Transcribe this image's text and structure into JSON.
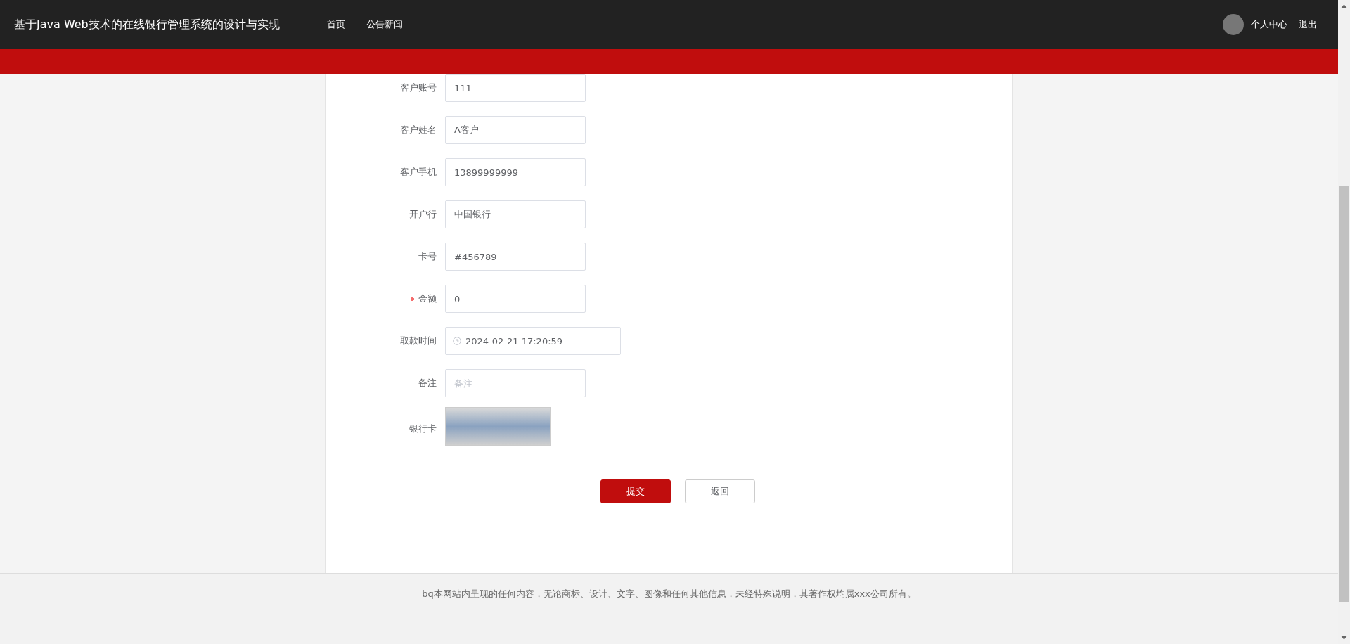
{
  "header": {
    "title": "基于Java Web技术的在线银行管理系统的设计与实现",
    "nav": [
      "首页",
      "公告新闻"
    ],
    "user_links": [
      "个人中心",
      "退出"
    ]
  },
  "form": {
    "fields": [
      {
        "kind": "text",
        "label": "客户账号",
        "required": false,
        "value": "111"
      },
      {
        "kind": "text",
        "label": "客户姓名",
        "required": false,
        "value": "A客户"
      },
      {
        "kind": "text",
        "label": "客户手机",
        "required": false,
        "value": "13899999999"
      },
      {
        "kind": "text",
        "label": "开户行",
        "required": false,
        "value": "中国银行"
      },
      {
        "kind": "text",
        "label": "卡号",
        "required": false,
        "value": "#456789"
      },
      {
        "kind": "text",
        "label": "金额",
        "required": true,
        "value": "0"
      },
      {
        "kind": "date",
        "label": "取款时间",
        "required": false,
        "value": "2024-02-21 17:20:59"
      },
      {
        "kind": "text",
        "label": "备注",
        "required": false,
        "placeholder": "备注"
      },
      {
        "kind": "image",
        "label": "银行卡",
        "required": false
      }
    ],
    "buttons": [
      {
        "label": "提交",
        "kind": "primary"
      },
      {
        "label": "返回",
        "kind": "plain"
      }
    ]
  },
  "footer": "bq本网站内呈现的任何内容，无论商标、设计、文字、图像和任何其他信息，未经特殊说明，其著作权均属xxx公司所有。"
}
